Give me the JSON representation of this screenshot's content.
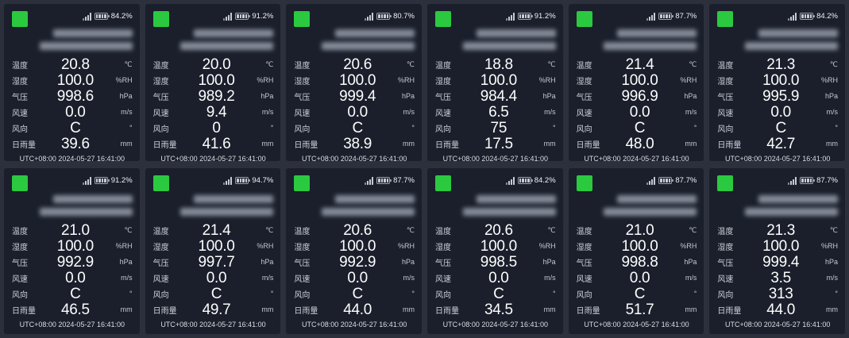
{
  "colors": {
    "page_background": "#2b303c",
    "card_background": "#1a1f2b",
    "status_online": "#2bc940",
    "value_text": "#fdfdfe"
  },
  "fields": [
    {
      "key": "temperature",
      "label": "温度",
      "unit": "℃"
    },
    {
      "key": "humidity",
      "label": "湿度",
      "unit": "%RH"
    },
    {
      "key": "pressure",
      "label": "气压",
      "unit": "hPa"
    },
    {
      "key": "wind_speed",
      "label": "风速",
      "unit": "m/s"
    },
    {
      "key": "wind_direction",
      "label": "风向",
      "unit": "°"
    },
    {
      "key": "daily_rainfall",
      "label": "日雨量",
      "unit": "mm"
    }
  ],
  "stations": [
    {
      "battery": "84.2%",
      "temperature": "20.8",
      "humidity": "100.0",
      "pressure": "998.6",
      "wind_speed": "0.0",
      "wind_direction": "C",
      "daily_rainfall": "39.6",
      "timestamp": "UTC+08:00 2024-05-27 16:41:00"
    },
    {
      "battery": "91.2%",
      "temperature": "20.0",
      "humidity": "100.0",
      "pressure": "989.2",
      "wind_speed": "9.4",
      "wind_direction": "0",
      "daily_rainfall": "41.6",
      "timestamp": "UTC+08:00 2024-05-27 16:41:00"
    },
    {
      "battery": "80.7%",
      "temperature": "20.6",
      "humidity": "100.0",
      "pressure": "999.4",
      "wind_speed": "0.0",
      "wind_direction": "C",
      "daily_rainfall": "38.9",
      "timestamp": "UTC+08:00 2024-05-27 16:41:00"
    },
    {
      "battery": "91.2%",
      "temperature": "18.8",
      "humidity": "100.0",
      "pressure": "984.4",
      "wind_speed": "6.5",
      "wind_direction": "75",
      "daily_rainfall": "17.5",
      "timestamp": "UTC+08:00 2024-05-27 16:41:00"
    },
    {
      "battery": "87.7%",
      "temperature": "21.4",
      "humidity": "100.0",
      "pressure": "996.9",
      "wind_speed": "0.0",
      "wind_direction": "C",
      "daily_rainfall": "48.0",
      "timestamp": "UTC+08:00 2024-05-27 16:41:00"
    },
    {
      "battery": "84.2%",
      "temperature": "21.3",
      "humidity": "100.0",
      "pressure": "995.9",
      "wind_speed": "0.0",
      "wind_direction": "C",
      "daily_rainfall": "42.7",
      "timestamp": "UTC+08:00 2024-05-27 16:41:00"
    },
    {
      "battery": "91.2%",
      "temperature": "21.0",
      "humidity": "100.0",
      "pressure": "992.9",
      "wind_speed": "0.0",
      "wind_direction": "C",
      "daily_rainfall": "46.5",
      "timestamp": "UTC+08:00 2024-05-27 16:41:00"
    },
    {
      "battery": "94.7%",
      "temperature": "21.4",
      "humidity": "100.0",
      "pressure": "997.7",
      "wind_speed": "0.0",
      "wind_direction": "C",
      "daily_rainfall": "49.7",
      "timestamp": "UTC+08:00 2024-05-27 16:41:00"
    },
    {
      "battery": "87.7%",
      "temperature": "20.6",
      "humidity": "100.0",
      "pressure": "992.9",
      "wind_speed": "0.0",
      "wind_direction": "C",
      "daily_rainfall": "44.0",
      "timestamp": "UTC+08:00 2024-05-27 16:41:00"
    },
    {
      "battery": "84.2%",
      "temperature": "20.6",
      "humidity": "100.0",
      "pressure": "998.5",
      "wind_speed": "0.0",
      "wind_direction": "C",
      "daily_rainfall": "34.5",
      "timestamp": "UTC+08:00 2024-05-27 16:41:00"
    },
    {
      "battery": "87.7%",
      "temperature": "21.0",
      "humidity": "100.0",
      "pressure": "998.8",
      "wind_speed": "0.0",
      "wind_direction": "C",
      "daily_rainfall": "51.7",
      "timestamp": "UTC+08:00 2024-05-27 16:41:00"
    },
    {
      "battery": "87.7%",
      "temperature": "21.3",
      "humidity": "100.0",
      "pressure": "999.4",
      "wind_speed": "3.5",
      "wind_direction": "313",
      "daily_rainfall": "44.0",
      "timestamp": "UTC+08:00 2024-05-27 16:41:00"
    }
  ]
}
